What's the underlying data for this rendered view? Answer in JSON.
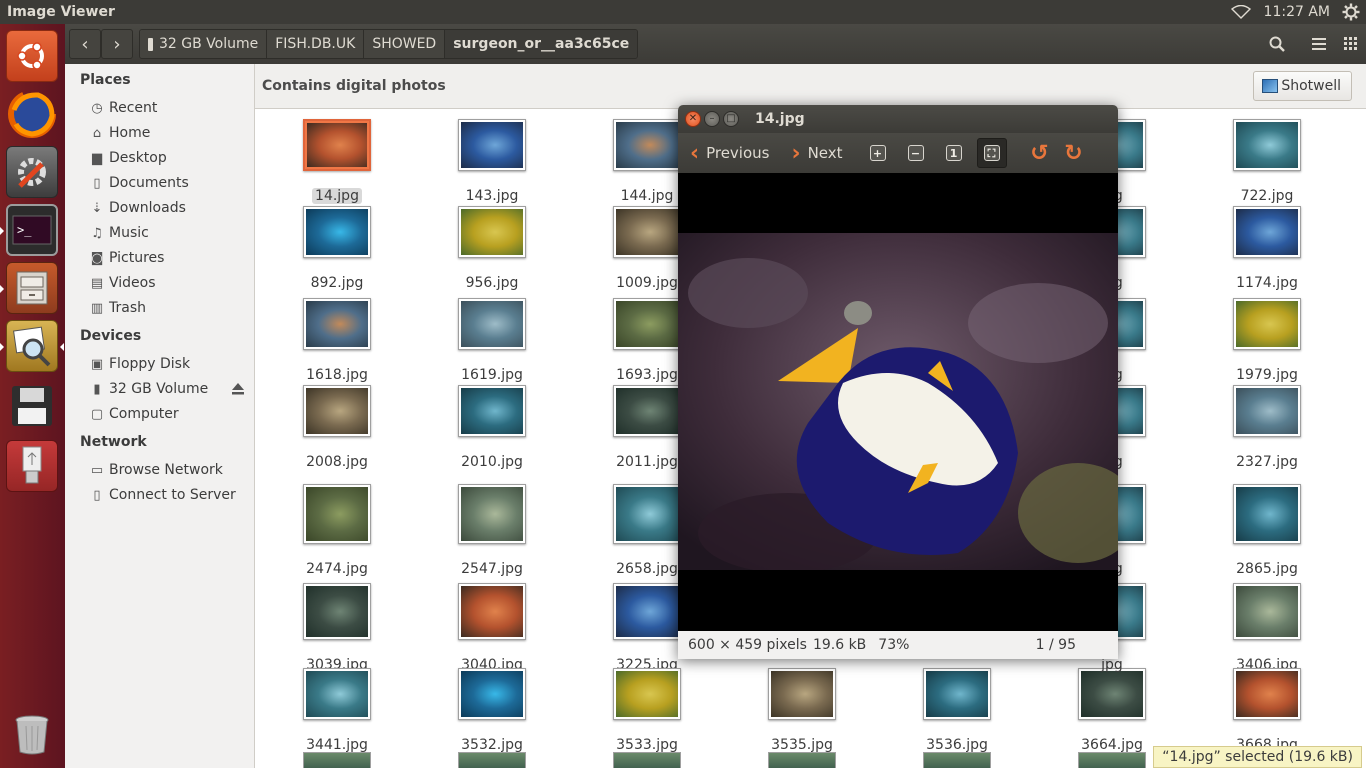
{
  "app_title": "Image Viewer",
  "top_panel": {
    "clock": "11:27 AM",
    "wifi_icon": "wifi-icon",
    "settings_icon": "gear-icon"
  },
  "launcher": {
    "items": [
      {
        "name": "ubuntu-dash",
        "icon": "ubuntu-logo-icon"
      },
      {
        "name": "firefox",
        "icon": "firefox-icon"
      },
      {
        "name": "system-settings",
        "icon": "settings-icon"
      },
      {
        "name": "terminal",
        "icon": "terminal-icon"
      },
      {
        "name": "files",
        "icon": "file-cabinet-icon"
      },
      {
        "name": "image-viewer",
        "icon": "image-viewer-icon"
      },
      {
        "name": "floppy-disk",
        "icon": "floppy-icon"
      },
      {
        "name": "usb-drive",
        "icon": "usb-icon"
      },
      {
        "name": "trash",
        "icon": "trash-icon"
      }
    ]
  },
  "headerbar": {
    "breadcrumbs": [
      "32 GB Volume",
      "FISH.DB.UK",
      "SHOWED",
      "surgeon_or__aa3c65ce"
    ]
  },
  "sidebar": {
    "places_heading": "Places",
    "places": [
      "Recent",
      "Home",
      "Desktop",
      "Documents",
      "Downloads",
      "Music",
      "Pictures",
      "Videos",
      "Trash"
    ],
    "devices_heading": "Devices",
    "devices": [
      "Floppy Disk",
      "32 GB Volume",
      "Computer"
    ],
    "network_heading": "Network",
    "network": [
      "Browse Network",
      "Connect to Server"
    ]
  },
  "infobar": {
    "text": "Contains digital photos",
    "button": "Shotwell"
  },
  "files": [
    [
      "14.jpg",
      "143.jpg",
      "144.jpg",
      "",
      "",
      "",
      "722.jpg"
    ],
    [
      "892.jpg",
      "956.jpg",
      "1009.jpg",
      "",
      "",
      "",
      "1174.jpg"
    ],
    [
      "1618.jpg",
      "1619.jpg",
      "1693.jpg",
      "",
      "",
      "",
      "1979.jpg"
    ],
    [
      "2008.jpg",
      "2010.jpg",
      "2011.jpg",
      "",
      "",
      "",
      "2327.jpg"
    ],
    [
      "2474.jpg",
      "2547.jpg",
      "2658.jpg",
      "",
      "",
      "",
      "2865.jpg"
    ],
    [
      "3039.jpg",
      "3040.jpg",
      "3225.jpg",
      "",
      "",
      "",
      "3406.jpg"
    ],
    [
      "3441.jpg",
      "3532.jpg",
      "3533.jpg",
      "3535.jpg",
      "3536.jpg",
      "3664.jpg",
      "3668.jpg"
    ]
  ],
  "partial_captions": {
    "col6": "jpg"
  },
  "viewer": {
    "title": "14.jpg",
    "previous": "Previous",
    "next": "Next",
    "dimensions": "600 × 459 pixels",
    "size": "19.6 kB",
    "zoom": "73%",
    "position": "1 / 95"
  },
  "selection_status": "“14.jpg” selected  (19.6 kB)"
}
